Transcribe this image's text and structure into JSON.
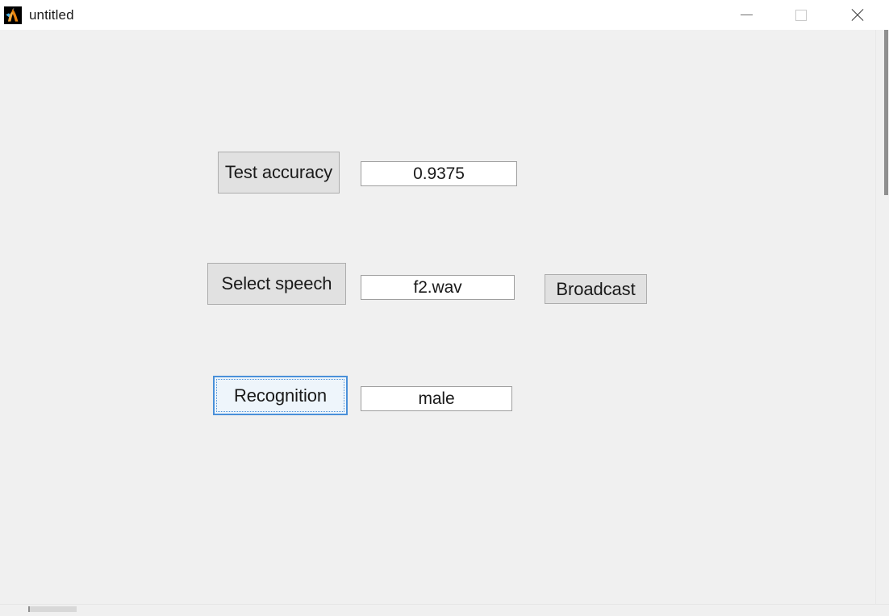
{
  "window": {
    "title": "untitled",
    "app_icon": "matlab-membrane-icon",
    "controls": {
      "minimize": "minimize-icon",
      "maximize": "maximize-icon",
      "close": "close-icon"
    }
  },
  "figure": {
    "background_color": "#f0f0f0",
    "rows": {
      "test_accuracy": {
        "button_label": "Test accuracy",
        "value": "0.9375"
      },
      "select_speech": {
        "button_label": "Select speech",
        "value": "f2.wav",
        "broadcast_label": "Broadcast"
      },
      "recognition": {
        "button_label": "Recognition",
        "value": "male",
        "focused": true
      }
    }
  },
  "colors": {
    "titlebar": "#ffffff",
    "panel": "#f0f0f0",
    "button_face": "#e1e1e1",
    "button_border": "#adadad",
    "field_background": "#ffffff",
    "field_border": "#9e9e9e",
    "focus_blue": "#4a90d9",
    "focus_fill": "#eef5fb",
    "text": "#1a1a1a"
  }
}
